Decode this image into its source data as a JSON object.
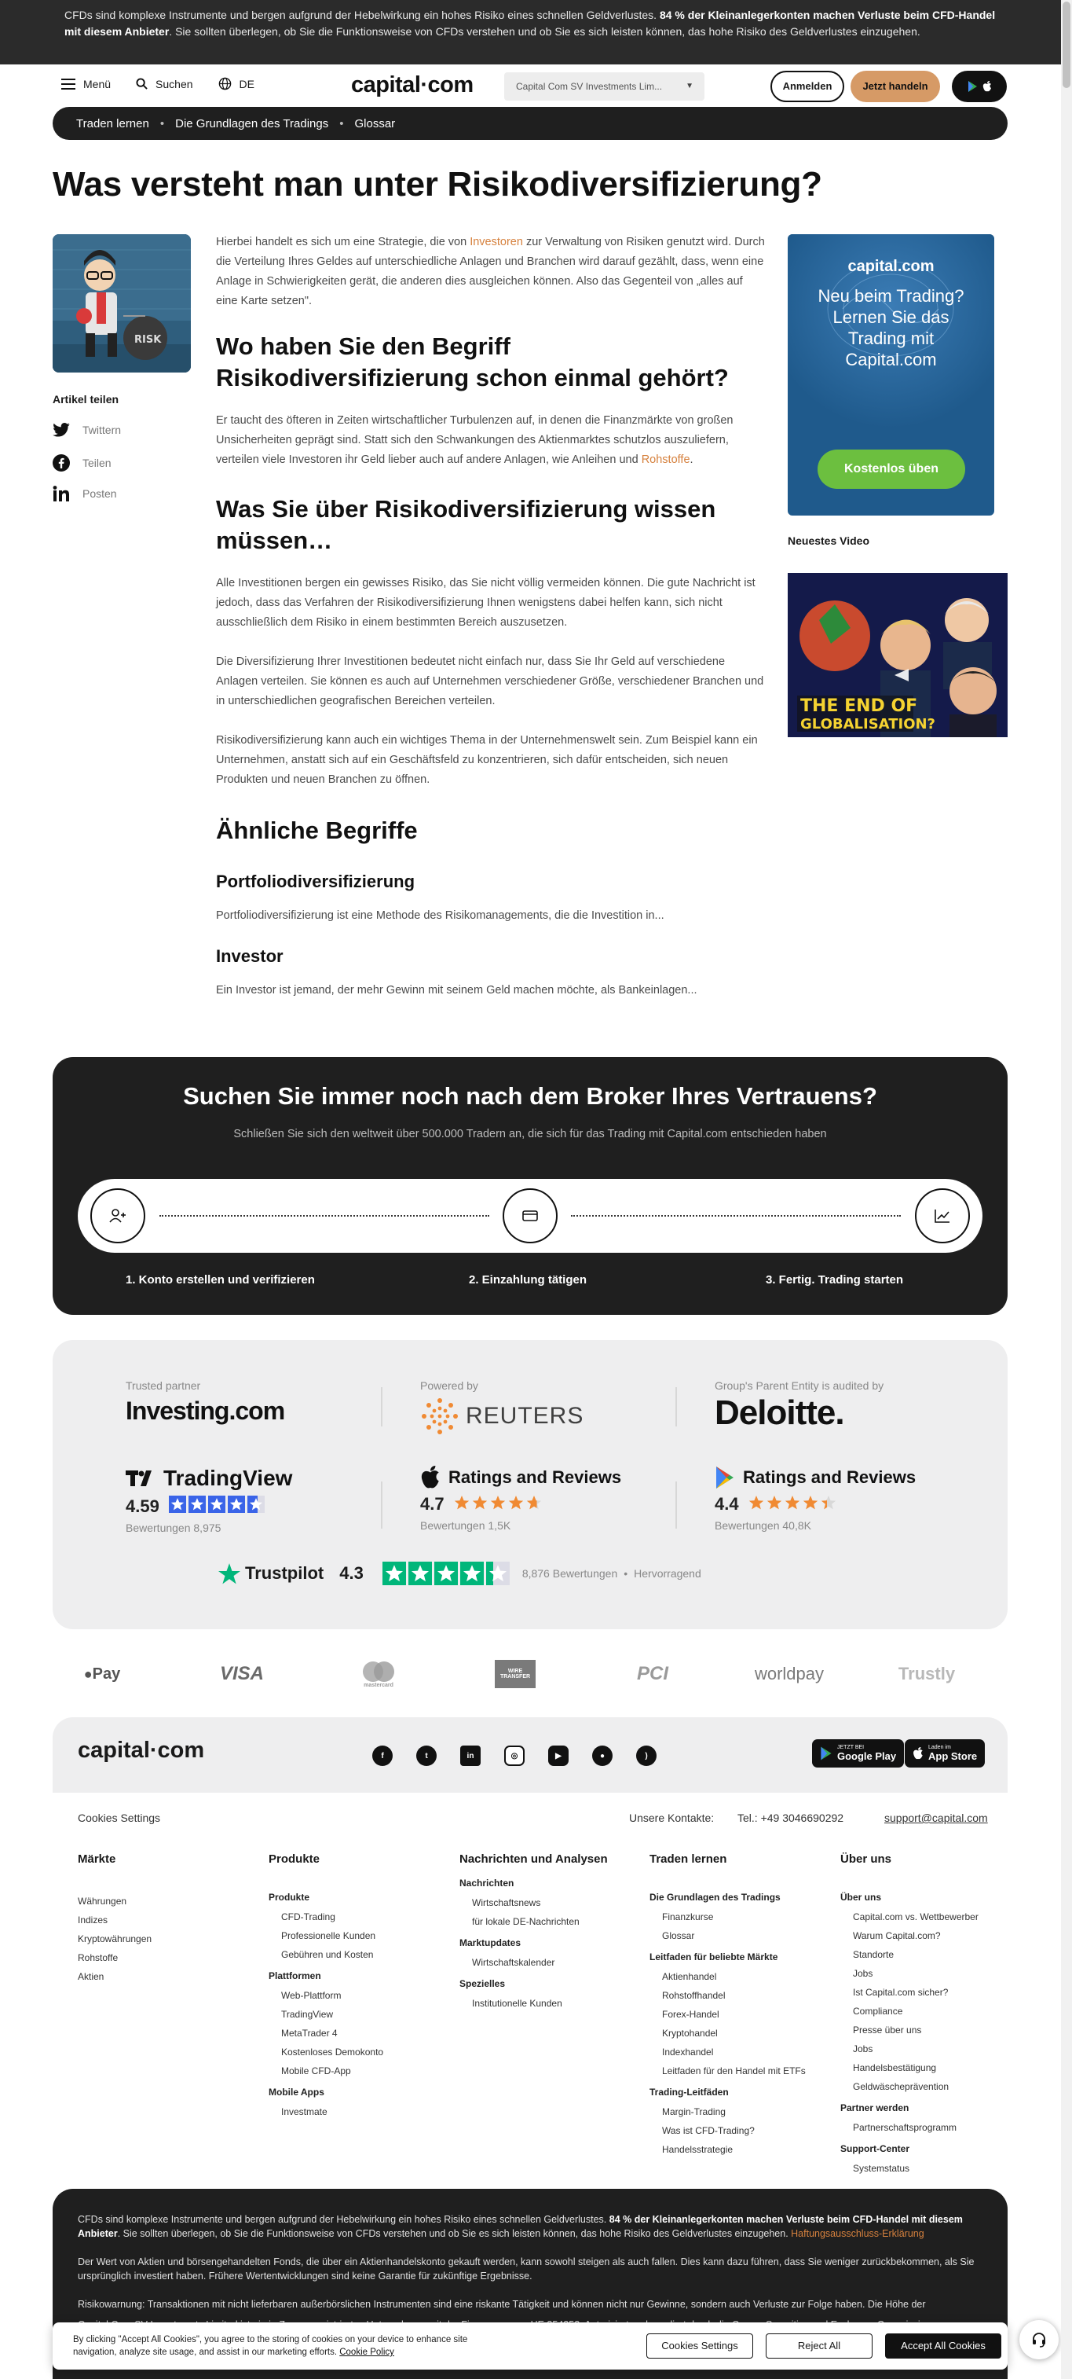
{
  "risk_banner": {
    "text_a": "CFDs sind komplexe Instrumente und bergen aufgrund der Hebelwirkung ein hohes Risiko eines schnellen Geldverlustes. ",
    "text_bold": "84 % der Kleinanlegerkonten machen Verluste beim CFD-Handel mit diesem Anbieter",
    "text_b": ". Sie sollten überlegen, ob Sie die Funktionsweise von CFDs verstehen und ob Sie es sich leisten können, das hohe Risiko des Geldverlustes einzugehen."
  },
  "header": {
    "menu_label": "Menü",
    "search_label": "Suchen",
    "language": "DE",
    "logo": "capital·com",
    "entity_select": "Capital Com SV Investments Lim...",
    "login_label": "Anmelden",
    "trade_label": "Jetzt handeln"
  },
  "breadcrumb": [
    "Traden lernen",
    "Die Grundlagen des Tradings",
    "Glossar"
  ],
  "page_title": "Was versteht man unter Risikodiversifizierung?",
  "illustration_text": "RISK",
  "share": {
    "title": "Artikel teilen",
    "items": [
      "Twittern",
      "Teilen",
      "Posten"
    ]
  },
  "article": {
    "intro_a": "Hierbei handelt es sich um eine Strategie, die von ",
    "intro_link": "Investoren",
    "intro_b": " zur Verwaltung von Risiken genutzt wird. Durch die Verteilung Ihres Geldes auf unterschiedliche Anlagen und Branchen wird darauf gezählt, dass, wenn eine Anlage in Schwierigkeiten gerät, die anderen dies ausgleichen können. Also das Gegenteil von „alles auf eine Karte setzen\".",
    "h2_where": "Wo haben Sie den Begriff Risikodiversifizierung schon einmal gehört?",
    "where_a": "Er taucht des öfteren in Zeiten wirtschaftlicher Turbulenzen auf, in denen die Finanzmärkte von großen Unsicherheiten geprägt sind. Statt sich den Schwankungen des Aktienmarktes schutzlos auszuliefern, verteilen viele Investoren ihr Geld lieber auch auf andere Anlagen, wie Anleihen und ",
    "where_link": "Rohstoffe",
    "where_b": ".",
    "h2_know": "Was Sie über Risikodiversifizierung wissen müssen…",
    "know_p1": "Alle Investitionen bergen ein gewisses Risiko, das Sie nicht völlig vermeiden können. Die gute Nachricht ist jedoch, dass das Verfahren der Risikodiversifizierung Ihnen wenigstens dabei helfen kann, sich nicht ausschließlich dem Risiko in einem bestimmten Bereich auszusetzen.",
    "know_p2": "Die Diversifizierung Ihrer Investitionen bedeutet nicht einfach nur, dass Sie Ihr Geld auf verschiedene Anlagen verteilen. Sie können es auch auf Unternehmen verschiedener Größe, verschiedener Branchen und in unterschiedlichen geografischen Bereichen verteilen.",
    "know_p3": "Risikodiversifizierung kann auch ein wichtiges Thema in der Unternehmenswelt sein. Zum Beispiel kann ein Unternehmen, anstatt sich auf ein Geschäftsfeld zu konzentrieren, sich dafür entscheiden, sich neuen Produkten und neuen Branchen zu öffnen.",
    "h2_related": "Ähnliche Begriffe",
    "related": [
      {
        "title": "Portfoliodiversifizierung",
        "text": "Portfoliodiversifizierung ist eine Methode des Risikomanagements, die die Investition in..."
      },
      {
        "title": "Investor",
        "text": "Ein Investor ist jemand, der mehr Gewinn mit seinem Geld machen möchte, als Bankeinlagen..."
      }
    ]
  },
  "promo": {
    "logo": "capital.com",
    "text": "Neu beim Trading? Lernen Sie das Trading mit Capital.com",
    "button": "Kostenlos üben"
  },
  "video": {
    "section_title": "Neuestes Video",
    "caption_line1": "THE END OF",
    "caption_line2": "GLOBALISATION?"
  },
  "broker": {
    "title": "Suchen Sie immer noch nach dem Broker Ihres Vertrauens?",
    "subtitle": "Schließen Sie sich den weltweit über 500.000 Tradern an, die sich für das Trading mit Capital.com entschieden haben",
    "steps": [
      "1. Konto erstellen und verifizieren",
      "2. Einzahlung tätigen",
      "3. Fertig. Trading starten"
    ]
  },
  "trust": {
    "partners": [
      {
        "caption": "Trusted partner",
        "name": "Investing.com"
      },
      {
        "caption": "Powered by",
        "name": "REUTERS"
      },
      {
        "caption": "Group's Parent Entity is audited by",
        "name": "Deloitte."
      }
    ],
    "ratings": [
      {
        "name": "TradingView",
        "score": "4.59",
        "count": "Bewertungen 8,975",
        "stars": 4.59
      },
      {
        "name": "Ratings and Reviews",
        "score": "4.7",
        "count": "Bewertungen 1,5K",
        "stars": 4.7
      },
      {
        "name": "Ratings and Reviews",
        "score": "4.4",
        "count": "Bewertungen 40,8K",
        "stars": 4.4
      }
    ],
    "trustpilot": {
      "name": "Trustpilot",
      "score": "4.3",
      "count": "8,876 Bewertungen",
      "sep": "•",
      "label": "Hervorragend",
      "stars": 4.3
    }
  },
  "payments": [
    "Pay",
    "VISA",
    "mastercard",
    "WIRE TRANSFER",
    "PCI",
    "worldpay",
    "Trustly"
  ],
  "footer": {
    "logo": "capital·com",
    "social": [
      "facebook-icon",
      "twitter-icon",
      "linkedin-icon",
      "instagram-icon",
      "youtube-icon",
      "reddit-icon",
      "rss-icon"
    ],
    "google_play": {
      "small": "JETZT BEI",
      "big": "Google Play"
    },
    "app_store": {
      "small": "Laden im",
      "big": "App Store"
    },
    "cookies_settings": "Cookies Settings",
    "contacts_label": "Unsere Kontakte:",
    "phone": "Tel.: +49 3046690292",
    "email": "support@capital.com",
    "columns": [
      {
        "title": "Märkte",
        "groups": [
          {
            "name": "",
            "links": [
              "Währungen",
              "Indizes",
              "Kryptowährungen",
              "Rohstoffe",
              "Aktien"
            ]
          }
        ]
      },
      {
        "title": "Produkte",
        "groups": [
          {
            "name": "Produkte",
            "links": [
              "CFD-Trading",
              "Professionelle Kunden",
              "Gebühren und Kosten"
            ]
          },
          {
            "name": "Plattformen",
            "links": [
              "Web-Plattform",
              "TradingView",
              "MetaTrader 4",
              "Kostenloses Demokonto",
              "Mobile CFD-App"
            ]
          },
          {
            "name": "Mobile Apps",
            "links": [
              "Investmate"
            ]
          }
        ]
      },
      {
        "title": "Nachrichten und Analysen",
        "groups": [
          {
            "name": "Nachrichten",
            "links": [
              "Wirtschaftsnews",
              "für lokale DE-Nachrichten"
            ]
          },
          {
            "name": "Marktupdates",
            "links": [
              "Wirtschaftskalender"
            ]
          },
          {
            "name": "Spezielles",
            "links": [
              "Institutionelle Kunden"
            ]
          }
        ]
      },
      {
        "title": "Traden lernen",
        "groups": [
          {
            "name": "Die Grundlagen des Tradings",
            "links": [
              "Finanzkurse",
              "Glossar"
            ]
          },
          {
            "name": "Leitfaden für beliebte Märkte",
            "links": [
              "Aktienhandel",
              "Rohstoffhandel",
              "Forex-Handel",
              "Kryptohandel",
              "Indexhandel",
              "Leitfaden für den Handel mit ETFs"
            ]
          },
          {
            "name": "Trading-Leitfäden",
            "links": [
              "Margin-Trading",
              "Was ist CFD-Trading?",
              "Handelsstrategie"
            ]
          }
        ]
      },
      {
        "title": "Über uns",
        "groups": [
          {
            "name": "Über uns",
            "links": [
              "Capital.com vs. Wettbewerber",
              "Warum Capital.com?",
              "Standorte",
              "Jobs",
              "Ist Capital.com sicher?",
              "Compliance",
              "Presse über uns",
              "Jobs",
              "Handelsbestätigung",
              "Geldwäscheprävention"
            ]
          },
          {
            "name": "Partner werden",
            "links": [
              "Partnerschaftsprogramm"
            ]
          },
          {
            "name": "Support-Center",
            "links": [
              "Systemstatus"
            ]
          }
        ]
      }
    ]
  },
  "disclaimer": {
    "p1_a": "CFDs sind komplexe Instrumente und bergen aufgrund der Hebelwirkung ein hohes Risiko eines schnellen Geldverlustes. ",
    "p1_bold": "84 % der Kleinanlegerkonten machen Verluste beim CFD-Handel mit diesem Anbieter",
    "p1_b": ". Sie sollten überlegen, ob Sie die Funktionsweise von CFDs verstehen und ob Sie es sich leisten können, das hohe Risiko des Geldverlustes einzugehen. ",
    "p1_link": "Haftungsausschluss-Erklärung",
    "p2": "Der Wert von Aktien und börsengehandelten Fonds, die über ein Aktienhandelskonto gekauft werden, kann sowohl steigen als auch fallen. Dies kann dazu führen, dass Sie weniger zurückbekommen, als Sie ursprünglich investiert haben. Frühere Wertentwicklungen sind keine Garantie für zukünftige Ergebnisse.",
    "p3": "Risikowarnung: Transaktionen mit nicht lieferbaren außerbörslichen Instrumenten sind eine riskante Tätigkeit und können nicht nur Gewinne, sondern auch Verluste zur Folge haben. Die Höhe der",
    "p4": "Capital Com SV Investments Limited ist ein in Zypern registriertes Unternehmen mit der Firmennummer HE 354252. Autorisiert und reguliert durch die Cyprus Securities and Exchange Commission"
  },
  "cookie_banner": {
    "text": "By clicking \"Accept All Cookies\", you agree to the storing of cookies on your device to enhance site navigation, analyze site usage, and assist in our marketing efforts. ",
    "policy_link": "Cookie Policy",
    "settings": "Cookies Settings",
    "reject": "Reject All",
    "accept": "Accept All Cookies"
  },
  "colors": {
    "accent": "#d69a66",
    "link": "#d6813e",
    "dark": "#1f1f1f",
    "promo": "#1f5a8c",
    "green": "#6cbf3f",
    "trustpilot": "#00b67a"
  }
}
